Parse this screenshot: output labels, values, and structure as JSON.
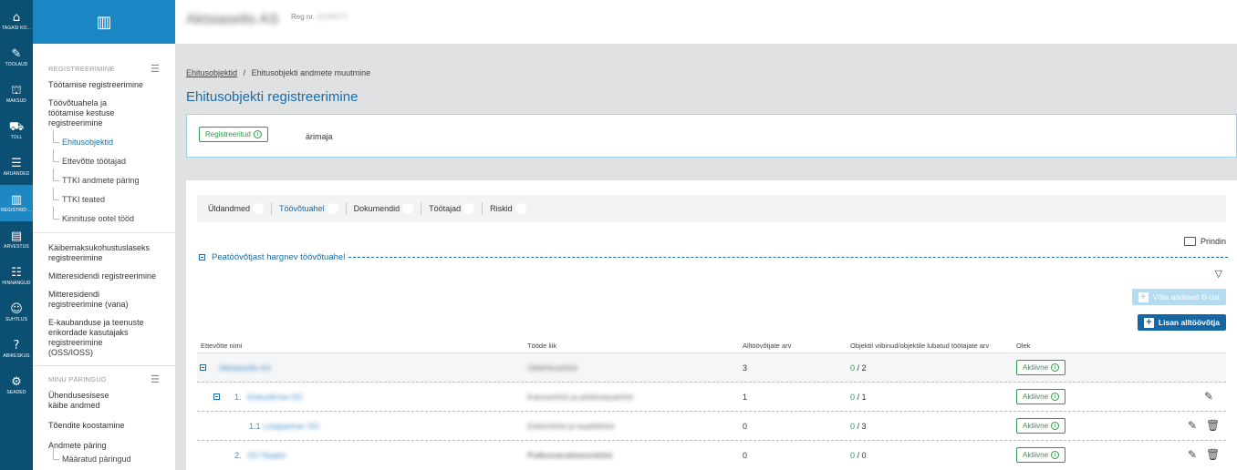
{
  "rail": [
    {
      "icon": "home-icon",
      "glyph": "⌂",
      "label": "TAGASI KO..."
    },
    {
      "icon": "tools-icon",
      "glyph": "✎",
      "label": "TÖÖLAUD"
    },
    {
      "icon": "bank-icon",
      "glyph": "⛫",
      "label": "MAKSUD"
    },
    {
      "icon": "truck-icon",
      "glyph": "⛟",
      "label": "TOLL"
    },
    {
      "icon": "report-icon",
      "glyph": "☰",
      "label": "ARUANDED"
    },
    {
      "icon": "books-icon",
      "glyph": "▥",
      "label": "REGISTRID ..."
    },
    {
      "icon": "calculator-icon",
      "glyph": "▤",
      "label": "ARVESTUS"
    },
    {
      "icon": "people-icon",
      "glyph": "☷",
      "label": "HINNANGUD"
    },
    {
      "icon": "chat-icon",
      "glyph": "☺",
      "label": "SUHTLUS"
    },
    {
      "icon": "help-icon",
      "glyph": "?",
      "label": "ABIKESKUS"
    },
    {
      "icon": "gear-icon",
      "glyph": "⚙",
      "label": "SEADED"
    }
  ],
  "sidebar": {
    "logo_icon": "registry-logo-icon",
    "section1": "REGISTREERIMINE",
    "link1": "Töötamise registreerimine",
    "link2": "Töövõtuahela ja töötamise kestuse registreerimine",
    "sub": [
      "Ehitusobjektid",
      "Ettevõtte töötajad",
      "TTKI andmete päring",
      "TTKI teated",
      "Kinnituse ootel tööd"
    ],
    "link3": "Käibemaksukohustuslaseks registreerimine",
    "link4": "Mitteresidendi registreerimine",
    "link5": "Mitteresidendi registreerimine (vana)",
    "link6": "E-kaubanduse ja teenuste erikordade kasutajaks registreerimine (OSS/IOSS)",
    "section2": "MINU PÄRINGUD",
    "link7": "Ühendusesisese käibe andmed",
    "link8": "Tõendite koostamine",
    "link9": "Andmete päring",
    "sub2": "Määratud päringud"
  },
  "topbar": {
    "company": "Aktsiaselts AS",
    "reg_label": "Reg nr.",
    "reg_value": "11194071"
  },
  "breadcrumb": {
    "link": "Ehitusobjektid",
    "sep": "/",
    "current": "Ehitusobjekti andmete muutmine"
  },
  "page_title": "Ehitusobjekti registreerimine",
  "status": {
    "badge": "Registreeritud",
    "object": "ärimaja"
  },
  "tabs": [
    "Üldandmed",
    "Töövõtuahel",
    "Dokumendid",
    "Töötajad",
    "Riskid"
  ],
  "print_label": "Prindin",
  "section_title": "Peatöövõtjast hargnev töövõtuahel",
  "buttons": {
    "import": "Võta andmed fil-üst",
    "add": "Lisan alltöövõtja"
  },
  "table": {
    "headers": [
      "Ettevõtte nimi",
      "Tööde liik",
      "Alltöövõtjate arv",
      "Objektil viibinud/objektile lubatud töötajate arv",
      "Olek"
    ],
    "rows": [
      {
        "prefix": "",
        "name": "Aktsiaselts AS",
        "work": "Üldehitustööd",
        "subs": "3",
        "present": "0",
        "allowed": "/ 2",
        "status": "Aktiivne"
      },
      {
        "prefix": "1.",
        "name": "Ehitusfirma OÜ",
        "work": "Katusetööd ja plekksepatööd",
        "subs": "1",
        "present": "0",
        "allowed": "/ 1",
        "status": "Aktiivne"
      },
      {
        "prefix": "1.1",
        "name": "Lisapartner OÜ",
        "work": "Elektritööd ja kaablitööd",
        "subs": "0",
        "present": "0",
        "allowed": "/ 3",
        "status": "Aktiivne"
      },
      {
        "prefix": "2.",
        "name": "OÜ Naabri",
        "work": "Puitkonstruktsioonitööd",
        "subs": "0",
        "present": "0",
        "allowed": "/ 0",
        "status": "Aktiivne"
      }
    ]
  }
}
